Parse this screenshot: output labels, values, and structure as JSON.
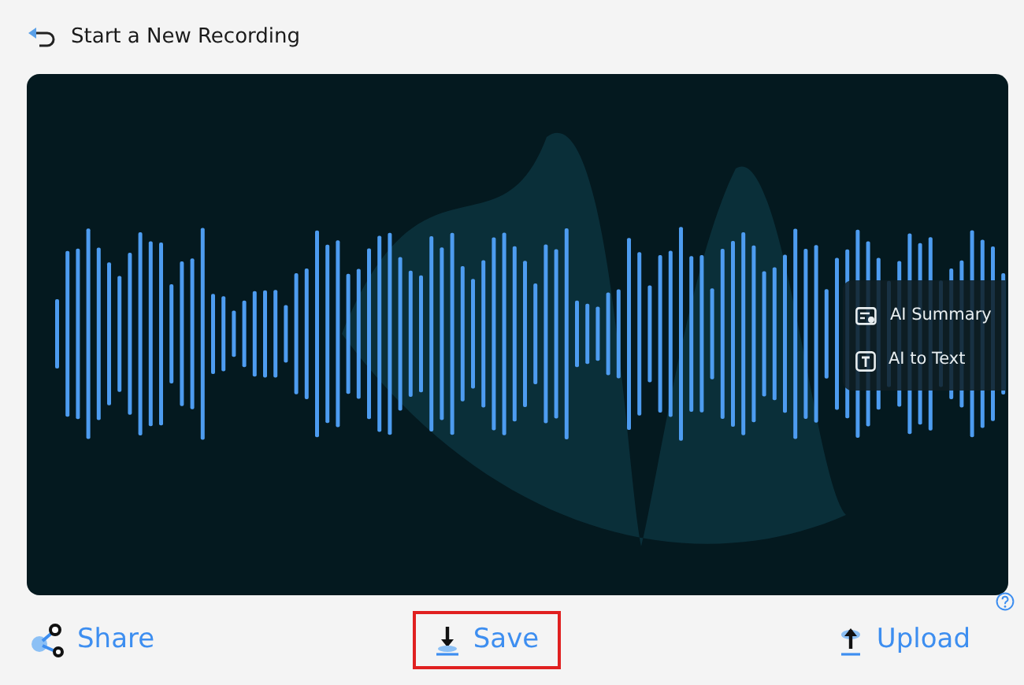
{
  "header": {
    "title": "Start a New Recording"
  },
  "ai_menu": [
    {
      "kind": "summary",
      "label": "AI Summary"
    },
    {
      "kind": "text",
      "label": "AI to Text"
    }
  ],
  "actions": [
    {
      "kind": "share",
      "label": "Share",
      "highlighted": false
    },
    {
      "kind": "save",
      "label": "Save",
      "highlighted": true
    },
    {
      "kind": "upload",
      "label": "Upload",
      "highlighted": false
    }
  ]
}
